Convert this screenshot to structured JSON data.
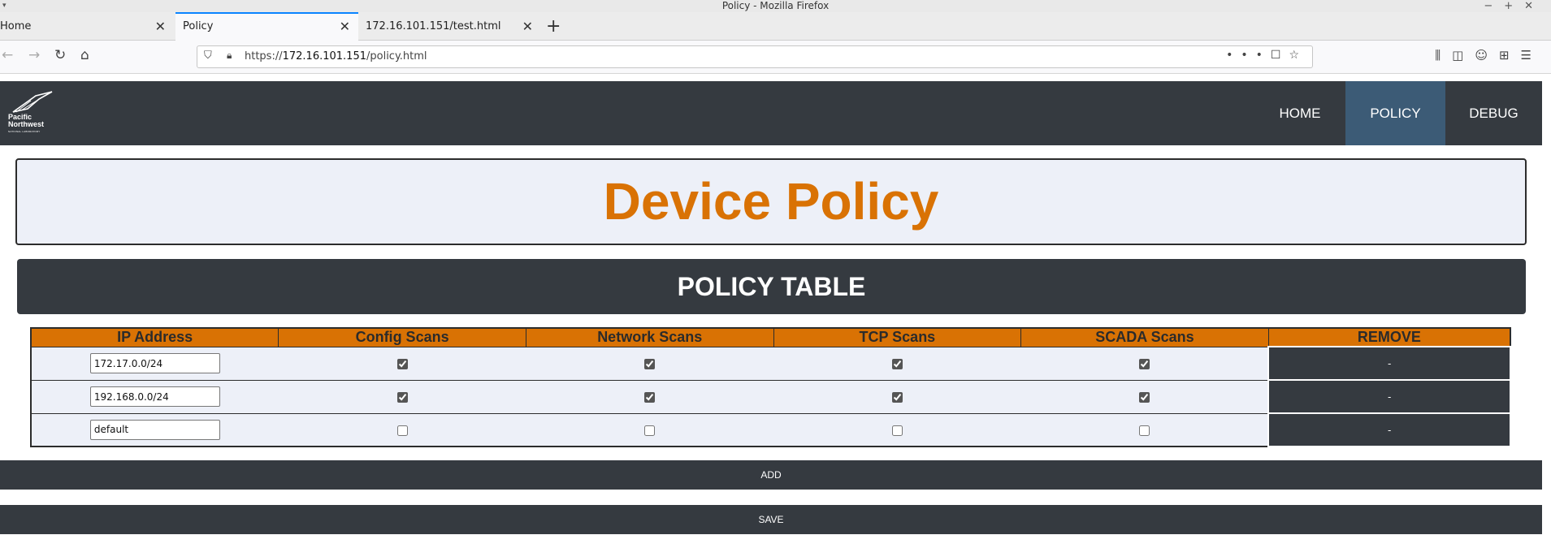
{
  "window": {
    "title": "Policy - Mozilla Firefox"
  },
  "tabs": [
    {
      "label": "Home"
    },
    {
      "label": "Policy"
    },
    {
      "label": "172.16.101.151/test.html"
    }
  ],
  "urlbar": {
    "prefix": "https://",
    "host": "172.16.101.151",
    "path": "/policy.html"
  },
  "site": {
    "logo": {
      "line1": "Pacific",
      "line2": "Northwest",
      "line3": "NATIONAL LABORATORY"
    },
    "nav": [
      {
        "label": "HOME"
      },
      {
        "label": "POLICY",
        "active": true
      },
      {
        "label": "DEBUG"
      }
    ]
  },
  "page": {
    "title": "Device Policy",
    "table_heading": "POLICY TABLE",
    "columns": [
      "IP Address",
      "Config Scans",
      "Network Scans",
      "TCP Scans",
      "SCADA Scans",
      "REMOVE"
    ],
    "rows": [
      {
        "ip": "172.17.0.0/24",
        "config": true,
        "network": true,
        "tcp": true,
        "scada": true,
        "remove": "-"
      },
      {
        "ip": "192.168.0.0/24",
        "config": true,
        "network": true,
        "tcp": true,
        "scada": true,
        "remove": "-"
      },
      {
        "ip": "default",
        "config": false,
        "network": false,
        "tcp": false,
        "scada": false,
        "remove": "-"
      }
    ],
    "add_label": "ADD",
    "save_label": "SAVE"
  },
  "colors": {
    "accent": "#d97204",
    "dark": "#353a40",
    "nav_active": "#3c5b76",
    "panel": "#edf0f8"
  }
}
